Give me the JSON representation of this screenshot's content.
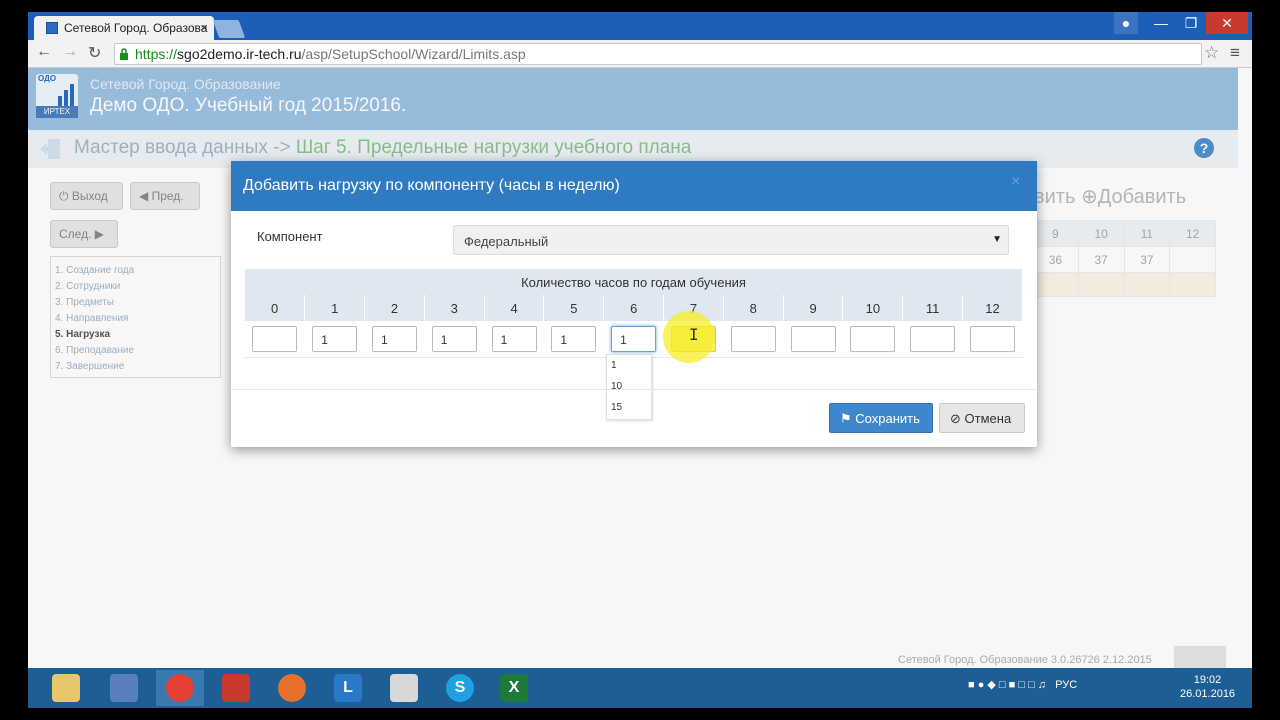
{
  "browser": {
    "tab_title": "Сетевой Город. Образова",
    "tab_close": "×",
    "url_proto": "https://",
    "url_host": "sgo2demo.ir-tech.ru",
    "url_path": "/asp/SetupSchool/Wizard/Limits.asp"
  },
  "app": {
    "org_name": "Сетевой Город. Образование",
    "year_title": "Демо ОДО. Учебный год 2015/2016.",
    "logo_top": "ОДО",
    "logo_bottom": "ИРТЕХ"
  },
  "wizard": {
    "title_prefix": "Мастер ввода данных ->",
    "title_step": "Шаг 5. Предельные нагрузки учебного плана",
    "help": "?"
  },
  "sidebar": {
    "exit": "Выход",
    "prev": "Пред.",
    "next": "След.",
    "steps": [
      "1. Создание года",
      "2. Сотрудники",
      "3. Предметы",
      "4. Направления",
      "5. Нагрузка",
      "6. Преподавание",
      "7. Завершение"
    ]
  },
  "background": {
    "add_label": "вить",
    "add_label2": "Добавить",
    "cols": [
      "9",
      "10",
      "11",
      "12"
    ],
    "row1": [
      "36",
      "37",
      "37",
      ""
    ]
  },
  "modal": {
    "title": "Добавить нагрузку по компоненту (часы в неделю)",
    "close": "×",
    "component_label": "Компонент",
    "component_value": "Федеральный",
    "caption": "Количество часов по годам обучения",
    "years": [
      "0",
      "1",
      "2",
      "3",
      "4",
      "5",
      "6",
      "7",
      "8",
      "9",
      "10",
      "11",
      "12"
    ],
    "values": [
      "",
      "1",
      "1",
      "1",
      "1",
      "1",
      "1",
      "",
      "",
      "",
      "",
      "",
      ""
    ],
    "autocomplete": [
      "1",
      "10",
      "15"
    ],
    "save": "Сохранить",
    "cancel": "Отмена"
  },
  "footer": {
    "text": "Сетевой Город. Образование  3.0.26726  2.12.2015"
  },
  "taskbar": {
    "tray": "РУС",
    "time": "19:02",
    "date": "26.01.2016"
  }
}
